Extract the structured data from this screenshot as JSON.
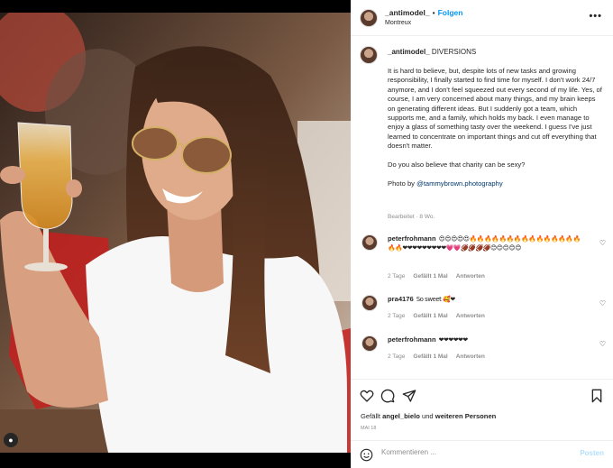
{
  "post": {
    "username": "_antimodel_",
    "follow_label": "Folgen",
    "location": "Montreux",
    "more_icon": "more-dots-icon"
  },
  "caption": {
    "username": "_antimodel_",
    "title": "DIVERSIONS",
    "paragraph1": "It is hard to believe, but, despite lots of new tasks and growing responsibility, I finally started to find time for myself. I don't work 24/7 anymore, and I don't feel squeezed out every second of my life. Yes, of course, I am very concerned about many things, and my brain keeps on generating different ideas. But I suddenly got a team, which supports me, and a family, which holds my back. I even manage to enjoy a glass of something tasty over the weekend. I guess I've just learned to concentrate on important things and cut off everything that doesn't matter.",
    "paragraph2": "Do you also believe that charity can be sexy?",
    "photo_by": "Photo by",
    "photo_mention": "@tammybrown.photography",
    "edited": "Bearbeitet · 8 Wo."
  },
  "comments": [
    {
      "username": "peterfrohmann",
      "text": "😍😍😍😍😍🔥🔥🔥🔥🔥🔥🔥🔥🔥🔥🔥🔥🔥🔥🔥🔥🔥❤❤❤❤❤❤❤❤❤💗💗🏈🏈🏈🏈😊😊😊😊😊",
      "time": "2 Tage",
      "likes": "Gefällt 1 Mal",
      "reply": "Antworten"
    },
    {
      "username": "pra4176",
      "text": "So sweet 🥰❤",
      "time": "2 Tage",
      "likes": "Gefällt 1 Mal",
      "reply": "Antworten"
    },
    {
      "username": "peterfrohmann",
      "text": "❤❤❤❤❤❤",
      "time": "2 Tage",
      "likes": "Gefällt 1 Mal",
      "reply": "Antworten"
    }
  ],
  "likes": {
    "prefix": "Gefällt",
    "user": "angel_bielo",
    "middle": "und",
    "others": "weiteren Personen"
  },
  "date": "MAI 18",
  "composer": {
    "placeholder": "Kommentieren ...",
    "post_label": "Posten"
  },
  "colors": {
    "follow": "#0095f6",
    "mention": "#00376b",
    "post_disabled": "#b2dffc",
    "muted": "#8e8e8e"
  }
}
